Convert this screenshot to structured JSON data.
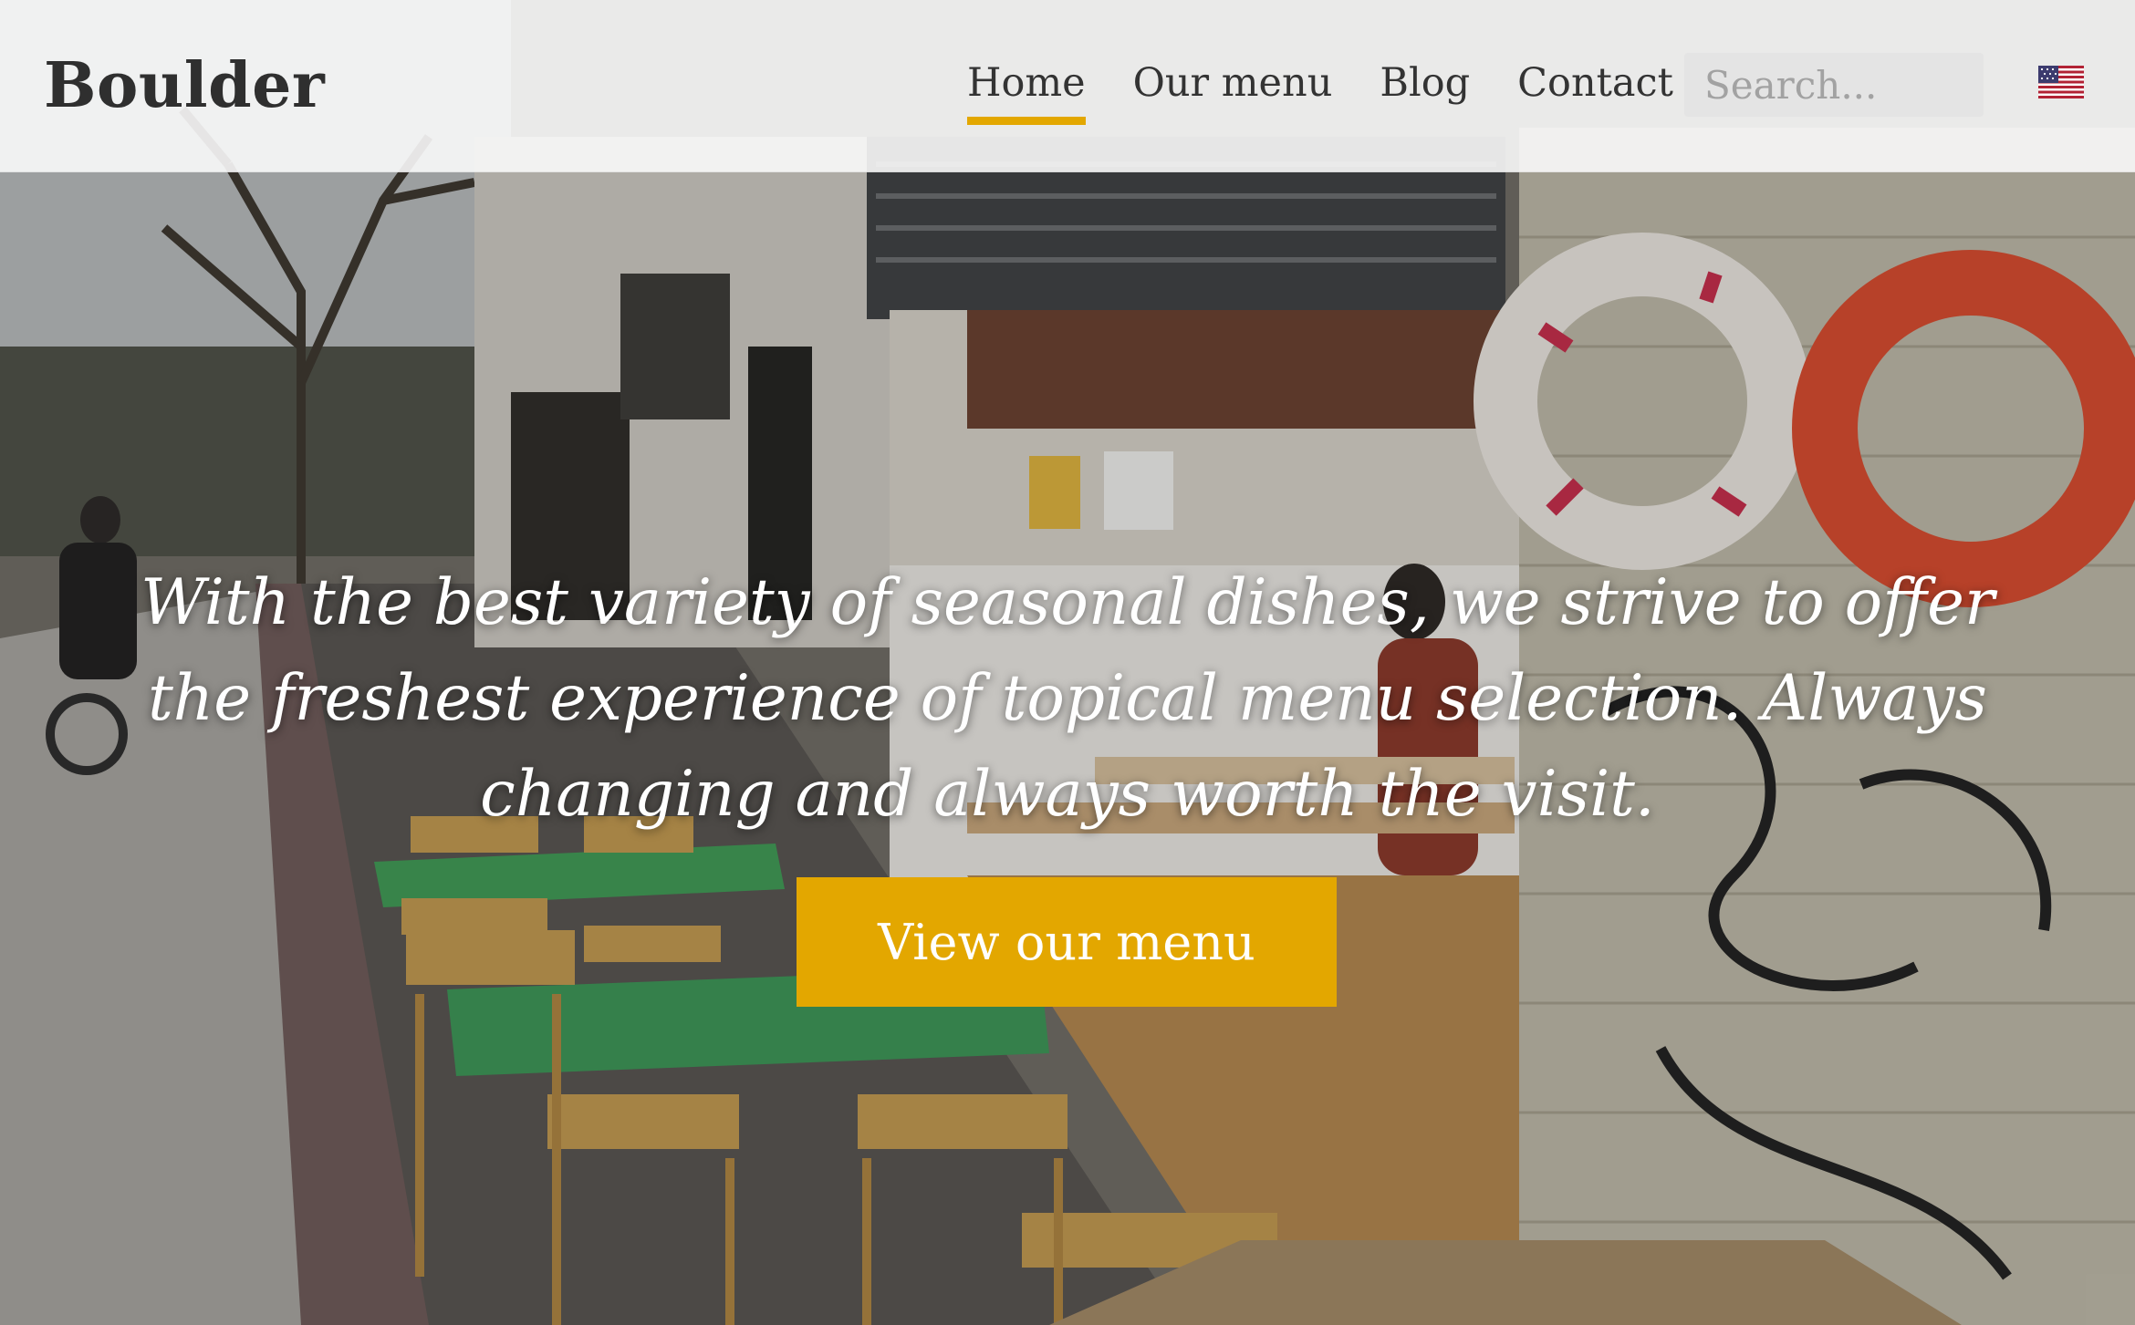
{
  "header": {
    "logo": "Boulder",
    "nav": [
      {
        "label": "Home",
        "active": true
      },
      {
        "label": "Our menu",
        "active": false
      },
      {
        "label": "Blog",
        "active": false
      },
      {
        "label": "Contact",
        "active": false
      }
    ],
    "search_placeholder": "Search...",
    "language_flag": "us-flag-icon"
  },
  "hero": {
    "tagline": "With the best variety of seasonal dishes, we strive to offer the freshest experience of topical menu selection. Always changing and always worth the visit.",
    "cta_label": "View our menu"
  },
  "colors": {
    "accent": "#e3a700",
    "header_bg": "#fafafa",
    "text_dark": "#333333",
    "search_bg": "#e4e4e4"
  }
}
